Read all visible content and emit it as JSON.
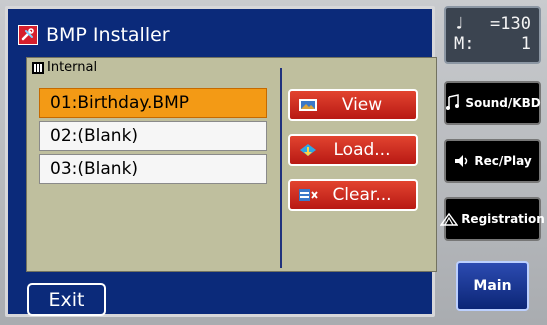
{
  "window": {
    "title": "BMP Installer",
    "icon": "tools-icon",
    "icon_color": "#d61f2c"
  },
  "storage": {
    "label": "Internal",
    "icon": "memory-icon"
  },
  "files": [
    {
      "label": "01:Birthday.BMP",
      "selected": true
    },
    {
      "label": "02:(Blank)",
      "selected": false
    },
    {
      "label": "03:(Blank)",
      "selected": false
    }
  ],
  "actions": {
    "view": {
      "label": "View",
      "icon": "image-icon"
    },
    "load": {
      "label": "Load...",
      "icon": "load-icon"
    },
    "clear": {
      "label": "Clear...",
      "icon": "clear-icon"
    }
  },
  "exit": {
    "label": "Exit"
  },
  "tempo": {
    "note_symbol": "♩",
    "tempo_value": "=130",
    "measure_label": "M:",
    "measure_value": "1"
  },
  "side_buttons": {
    "sound_kbd": "Sound/KBD",
    "rec_play": "Rec/Play",
    "registration": "Registration",
    "main": "Main"
  },
  "colors": {
    "screen_bg": "#0b2a7a",
    "panel_bg": "#bfbf9e",
    "selected_row": "#f39a15",
    "action_button": "#d52b22"
  }
}
